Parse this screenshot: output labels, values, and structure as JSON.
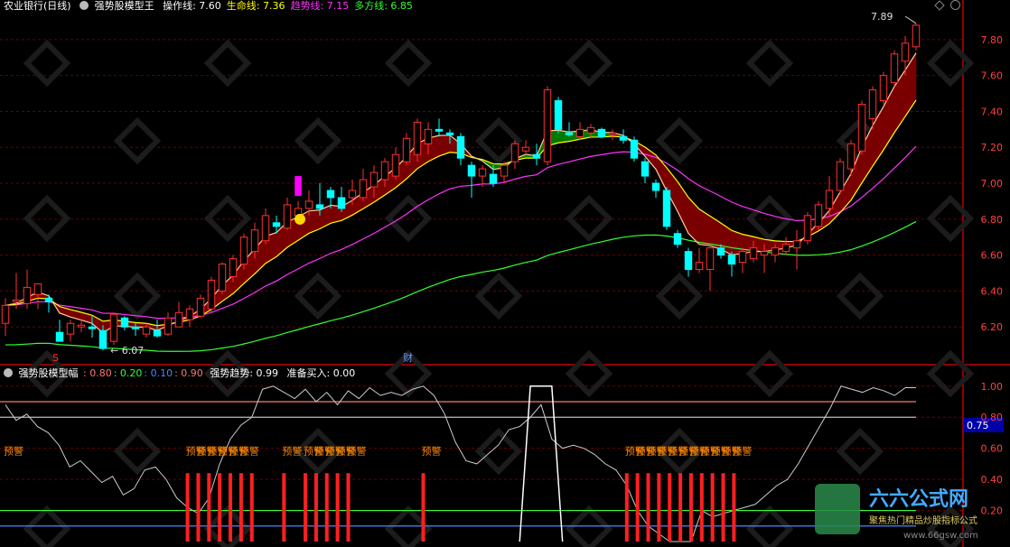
{
  "header": {
    "stock": "农业银行(日线)",
    "indicator": "强势股模型王",
    "lines": [
      {
        "label": "操作线",
        "value": "7.60",
        "color": "#ffffff"
      },
      {
        "label": "生命线",
        "value": "7.36",
        "color": "#ffff00"
      },
      {
        "label": "趋势线",
        "value": "7.15",
        "color": "#ff33ff"
      },
      {
        "label": "多方线",
        "value": "6.85",
        "color": "#33ff33"
      }
    ]
  },
  "sub_header": {
    "indicator": "强势股模型幅",
    "values": [
      {
        "value": "0.80",
        "color": "#ff7777"
      },
      {
        "value": "0.20",
        "color": "#33ff33"
      },
      {
        "value": "0.10",
        "color": "#4488ff"
      },
      {
        "value": "0.90",
        "color": "#ff7777"
      }
    ],
    "trend_label": "强势趋势",
    "trend_value": "0.99",
    "buy_label": "准备买入",
    "buy_value": "0.00"
  },
  "annotations": {
    "high": "7.89",
    "low": "6.07",
    "marker_s": "S",
    "marker_cai": "财",
    "warn": "预警",
    "sub_axis_current": "0.75",
    "watermark_brand": "六六公式网",
    "watermark_sub": "聚焦热门精品炒股指标公式",
    "watermark_url": "www.66gsw.com"
  },
  "colors": {
    "up": "#ff3030",
    "down": "#00ffff",
    "axis": "#c00000",
    "grid": "#6a0000",
    "band_up": "#7a0000",
    "band_down": "#007a00"
  },
  "chart_data": {
    "type": "candlestick",
    "y_axis": {
      "ticks": [
        6.2,
        6.4,
        6.6,
        6.8,
        7.0,
        7.2,
        7.4,
        7.6,
        7.8
      ],
      "range": [
        6.02,
        7.92
      ]
    },
    "candles": [
      {
        "o": 6.22,
        "h": 6.36,
        "l": 6.15,
        "c": 6.32
      },
      {
        "o": 6.34,
        "h": 6.5,
        "l": 6.3,
        "c": 6.35
      },
      {
        "o": 6.33,
        "h": 6.52,
        "l": 6.3,
        "c": 6.42
      },
      {
        "o": 6.38,
        "h": 6.44,
        "l": 6.3,
        "c": 6.44
      },
      {
        "o": 6.36,
        "h": 6.38,
        "l": 6.28,
        "c": 6.34
      },
      {
        "o": 6.17,
        "h": 6.24,
        "l": 6.12,
        "c": 6.12
      },
      {
        "o": 6.16,
        "h": 6.24,
        "l": 6.12,
        "c": 6.22
      },
      {
        "o": 6.2,
        "h": 6.24,
        "l": 6.17,
        "c": 6.21
      },
      {
        "o": 6.2,
        "h": 6.26,
        "l": 6.14,
        "c": 6.19
      },
      {
        "o": 6.18,
        "h": 6.21,
        "l": 6.07,
        "c": 6.08
      },
      {
        "o": 6.12,
        "h": 6.28,
        "l": 6.1,
        "c": 6.27
      },
      {
        "o": 6.25,
        "h": 6.26,
        "l": 6.18,
        "c": 6.2
      },
      {
        "o": 6.2,
        "h": 6.22,
        "l": 6.15,
        "c": 6.19
      },
      {
        "o": 6.16,
        "h": 6.22,
        "l": 6.14,
        "c": 6.2
      },
      {
        "o": 6.18,
        "h": 6.24,
        "l": 6.14,
        "c": 6.15
      },
      {
        "o": 6.16,
        "h": 6.28,
        "l": 6.15,
        "c": 6.25
      },
      {
        "o": 6.2,
        "h": 6.34,
        "l": 6.2,
        "c": 6.28
      },
      {
        "o": 6.24,
        "h": 6.32,
        "l": 6.2,
        "c": 6.3
      },
      {
        "o": 6.26,
        "h": 6.38,
        "l": 6.25,
        "c": 6.36
      },
      {
        "o": 6.3,
        "h": 6.48,
        "l": 6.28,
        "c": 6.46
      },
      {
        "o": 6.4,
        "h": 6.56,
        "l": 6.38,
        "c": 6.55
      },
      {
        "o": 6.48,
        "h": 6.6,
        "l": 6.45,
        "c": 6.58
      },
      {
        "o": 6.55,
        "h": 6.72,
        "l": 6.52,
        "c": 6.7
      },
      {
        "o": 6.62,
        "h": 6.78,
        "l": 6.58,
        "c": 6.74
      },
      {
        "o": 6.68,
        "h": 6.86,
        "l": 6.66,
        "c": 6.82
      },
      {
        "o": 6.78,
        "h": 6.82,
        "l": 6.72,
        "c": 6.76
      },
      {
        "o": 6.75,
        "h": 6.92,
        "l": 6.74,
        "c": 6.88
      },
      {
        "o": 6.82,
        "h": 6.9,
        "l": 6.78,
        "c": 6.86
      },
      {
        "o": 6.86,
        "h": 6.96,
        "l": 6.82,
        "c": 6.9
      },
      {
        "o": 6.88,
        "h": 7.0,
        "l": 6.82,
        "c": 6.86
      },
      {
        "o": 6.96,
        "h": 6.98,
        "l": 6.86,
        "c": 6.92
      },
      {
        "o": 6.92,
        "h": 6.98,
        "l": 6.84,
        "c": 6.86
      },
      {
        "o": 6.92,
        "h": 7.02,
        "l": 6.88,
        "c": 6.96
      },
      {
        "o": 6.92,
        "h": 7.08,
        "l": 6.9,
        "c": 7.02
      },
      {
        "o": 6.98,
        "h": 7.1,
        "l": 6.92,
        "c": 7.06
      },
      {
        "o": 7.02,
        "h": 7.14,
        "l": 6.98,
        "c": 7.12
      },
      {
        "o": 7.04,
        "h": 7.2,
        "l": 7.02,
        "c": 7.16
      },
      {
        "o": 7.12,
        "h": 7.28,
        "l": 7.1,
        "c": 7.25
      },
      {
        "o": 7.16,
        "h": 7.36,
        "l": 7.12,
        "c": 7.34
      },
      {
        "o": 7.22,
        "h": 7.34,
        "l": 7.16,
        "c": 7.3
      },
      {
        "o": 7.3,
        "h": 7.36,
        "l": 7.26,
        "c": 7.29
      },
      {
        "o": 7.28,
        "h": 7.3,
        "l": 7.22,
        "c": 7.27
      },
      {
        "o": 7.26,
        "h": 7.28,
        "l": 7.1,
        "c": 7.14
      },
      {
        "o": 7.1,
        "h": 7.12,
        "l": 6.92,
        "c": 7.04
      },
      {
        "o": 7.04,
        "h": 7.1,
        "l": 6.98,
        "c": 7.08
      },
      {
        "o": 7.05,
        "h": 7.1,
        "l": 6.98,
        "c": 7.0
      },
      {
        "o": 7.04,
        "h": 7.12,
        "l": 7.0,
        "c": 7.1
      },
      {
        "o": 7.12,
        "h": 7.24,
        "l": 7.08,
        "c": 7.22
      },
      {
        "o": 7.18,
        "h": 7.24,
        "l": 7.16,
        "c": 7.2
      },
      {
        "o": 7.16,
        "h": 7.22,
        "l": 7.1,
        "c": 7.14
      },
      {
        "o": 7.12,
        "h": 7.54,
        "l": 7.1,
        "c": 7.52
      },
      {
        "o": 7.46,
        "h": 7.48,
        "l": 7.28,
        "c": 7.3
      },
      {
        "o": 7.28,
        "h": 7.34,
        "l": 7.26,
        "c": 7.27
      },
      {
        "o": 7.26,
        "h": 7.34,
        "l": 7.24,
        "c": 7.3
      },
      {
        "o": 7.28,
        "h": 7.33,
        "l": 7.25,
        "c": 7.31
      },
      {
        "o": 7.3,
        "h": 7.31,
        "l": 7.25,
        "c": 7.26
      },
      {
        "o": 7.28,
        "h": 7.3,
        "l": 7.24,
        "c": 7.28
      },
      {
        "o": 7.26,
        "h": 7.3,
        "l": 7.22,
        "c": 7.24
      },
      {
        "o": 7.24,
        "h": 7.26,
        "l": 7.12,
        "c": 7.14
      },
      {
        "o": 7.12,
        "h": 7.14,
        "l": 7.0,
        "c": 7.04
      },
      {
        "o": 7.0,
        "h": 7.02,
        "l": 6.92,
        "c": 6.96
      },
      {
        "o": 6.96,
        "h": 6.98,
        "l": 6.74,
        "c": 6.76
      },
      {
        "o": 6.72,
        "h": 6.74,
        "l": 6.64,
        "c": 6.66
      },
      {
        "o": 6.62,
        "h": 6.64,
        "l": 6.48,
        "c": 6.52
      },
      {
        "o": 6.52,
        "h": 6.64,
        "l": 6.5,
        "c": 6.56
      },
      {
        "o": 6.52,
        "h": 6.66,
        "l": 6.4,
        "c": 6.64
      },
      {
        "o": 6.64,
        "h": 6.66,
        "l": 6.58,
        "c": 6.6
      },
      {
        "o": 6.6,
        "h": 6.62,
        "l": 6.48,
        "c": 6.55
      },
      {
        "o": 6.56,
        "h": 6.64,
        "l": 6.5,
        "c": 6.62
      },
      {
        "o": 6.58,
        "h": 6.68,
        "l": 6.56,
        "c": 6.64
      },
      {
        "o": 6.6,
        "h": 6.66,
        "l": 6.5,
        "c": 6.62
      },
      {
        "o": 6.6,
        "h": 6.66,
        "l": 6.56,
        "c": 6.64
      },
      {
        "o": 6.62,
        "h": 6.7,
        "l": 6.6,
        "c": 6.66
      },
      {
        "o": 6.64,
        "h": 6.74,
        "l": 6.52,
        "c": 6.68
      },
      {
        "o": 6.68,
        "h": 6.84,
        "l": 6.66,
        "c": 6.82
      },
      {
        "o": 6.76,
        "h": 6.9,
        "l": 6.74,
        "c": 6.88
      },
      {
        "o": 6.86,
        "h": 7.04,
        "l": 6.82,
        "c": 6.96
      },
      {
        "o": 6.96,
        "h": 7.14,
        "l": 6.94,
        "c": 7.12
      },
      {
        "o": 7.08,
        "h": 7.24,
        "l": 7.04,
        "c": 7.22
      },
      {
        "o": 7.18,
        "h": 7.46,
        "l": 7.16,
        "c": 7.44
      },
      {
        "o": 7.36,
        "h": 7.54,
        "l": 7.3,
        "c": 7.52
      },
      {
        "o": 7.46,
        "h": 7.62,
        "l": 7.44,
        "c": 7.6
      },
      {
        "o": 7.56,
        "h": 7.74,
        "l": 7.54,
        "c": 7.72
      },
      {
        "o": 7.68,
        "h": 7.82,
        "l": 7.6,
        "c": 7.78
      },
      {
        "o": 7.76,
        "h": 7.89,
        "l": 7.74,
        "c": 7.88
      }
    ],
    "band_green_ranges": [
      [
        43,
        55
      ]
    ],
    "sub_axis": {
      "ticks": [
        0.2,
        0.4,
        0.6,
        0.8,
        1.0
      ],
      "range": [
        0,
        1.08
      ]
    },
    "sub_levels": [
      {
        "value": 0.9,
        "color": "#ff7777"
      },
      {
        "value": 0.8,
        "color": "#bbbbbb"
      },
      {
        "value": 0.2,
        "color": "#33ff33"
      },
      {
        "value": 0.1,
        "color": "#4488ff"
      }
    ],
    "trend": [
      0.88,
      0.78,
      0.82,
      0.74,
      0.7,
      0.62,
      0.48,
      0.52,
      0.45,
      0.38,
      0.42,
      0.3,
      0.34,
      0.46,
      0.48,
      0.4,
      0.28,
      0.22,
      0.18,
      0.28,
      0.5,
      0.66,
      0.75,
      0.8,
      0.98,
      1.0,
      0.96,
      0.92,
      0.98,
      0.9,
      0.96,
      0.88,
      0.97,
      0.92,
      0.99,
      0.94,
      0.96,
      0.94,
      0.98,
      1.0,
      0.94,
      0.82,
      0.64,
      0.52,
      0.5,
      0.56,
      0.62,
      0.72,
      0.74,
      0.8,
      0.88,
      0.66,
      0.6,
      0.62,
      0.6,
      0.56,
      0.5,
      0.46,
      0.36,
      0.2,
      0.1,
      0.05,
      0.0,
      0.0,
      0.0,
      0.2,
      0.16,
      0.18,
      0.2,
      0.22,
      0.24,
      0.3,
      0.36,
      0.4,
      0.5,
      0.62,
      0.74,
      0.86,
      1.0,
      0.98,
      0.96,
      0.99,
      0.97,
      0.94,
      0.99,
      0.99
    ],
    "warn_bars": [
      17,
      18,
      19,
      20,
      21,
      22,
      23,
      26,
      28,
      29,
      30,
      31,
      32,
      39,
      58,
      59,
      60,
      61,
      62,
      63,
      64,
      65,
      66,
      67,
      68
    ],
    "warn_labels": [
      0,
      17,
      18,
      19,
      20,
      21,
      22,
      26,
      28,
      29,
      30,
      31,
      32,
      39,
      58,
      59,
      60,
      61,
      62,
      63,
      64,
      65,
      66,
      67,
      68
    ],
    "buy_pulse": [
      49,
      51
    ]
  }
}
